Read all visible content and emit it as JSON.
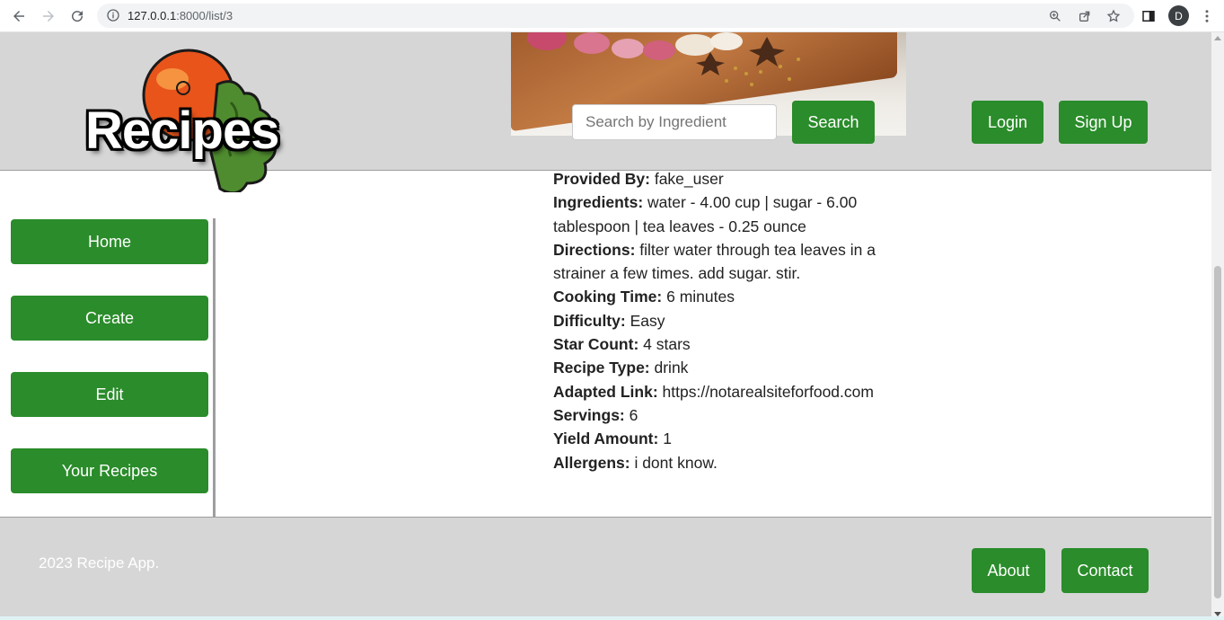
{
  "browser": {
    "url_host": "127.0.0.1",
    "url_rest": ":8000/list/3",
    "avatar_letter": "D"
  },
  "header": {
    "logo_text": "Recipes",
    "search_placeholder": "Search by Ingredient",
    "search_button": "Search",
    "login_button": "Login",
    "signup_button": "Sign Up"
  },
  "sidebar": {
    "items": [
      {
        "label": "Home"
      },
      {
        "label": "Create"
      },
      {
        "label": "Edit"
      },
      {
        "label": "Your Recipes"
      }
    ]
  },
  "recipe": {
    "provided_by_label": "Provided By:",
    "provided_by": "fake_user",
    "ingredients_label": "Ingredients:",
    "ingredients": "water - 4.00 cup | sugar - 6.00 tablespoon | tea leaves - 0.25 ounce",
    "directions_label": "Directions:",
    "directions": "filter water through tea leaves in a strainer a few times. add sugar. stir.",
    "cooking_time_label": "Cooking Time:",
    "cooking_time": "6 minutes",
    "difficulty_label": "Difficulty:",
    "difficulty": "Easy",
    "star_count_label": "Star Count:",
    "star_count": "4 stars",
    "recipe_type_label": "Recipe Type:",
    "recipe_type": "drink",
    "adapted_link_label": "Adapted Link:",
    "adapted_link": "https://notarealsiteforfood.com",
    "servings_label": "Servings:",
    "servings": "6",
    "yield_label": "Yield Amount:",
    "yield": "1",
    "allergens_label": "Allergens:",
    "allergens": "i dont know."
  },
  "footer": {
    "copyright": "2023 Recipe App.",
    "about_button": "About",
    "contact_button": "Contact"
  },
  "colors": {
    "accent_green": "#2a8c2a",
    "header_gray": "#d6d6d6"
  }
}
